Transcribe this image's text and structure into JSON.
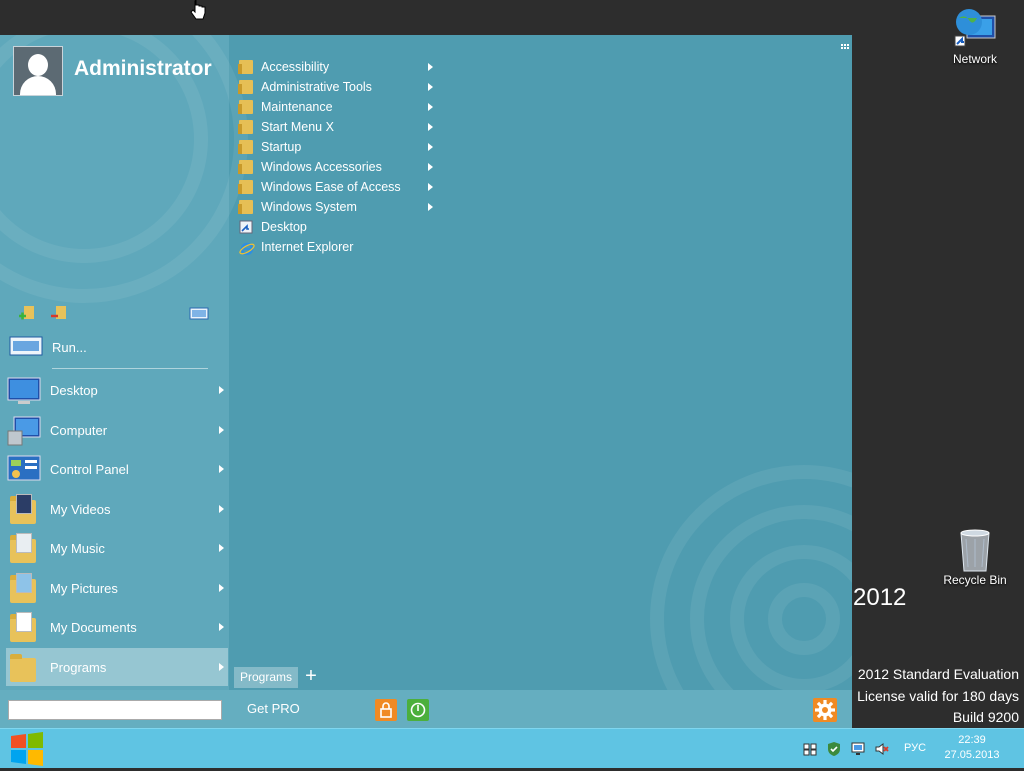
{
  "desktop": {
    "network_label": "Network",
    "recycle_label": "Recycle Bin",
    "watermark": {
      "year": "2012",
      "line1": "2012 Standard Evaluation",
      "line2": "License valid for 180 days",
      "line3": "Build 9200"
    }
  },
  "startmenu": {
    "username": "Administrator",
    "run_label": "Run...",
    "left_items": [
      {
        "label": "Desktop",
        "icon": "desktop-icon"
      },
      {
        "label": "Computer",
        "icon": "computer-icon"
      },
      {
        "label": "Control Panel",
        "icon": "control-panel-icon"
      },
      {
        "label": "My Videos",
        "icon": "videos-folder-icon"
      },
      {
        "label": "My Music",
        "icon": "music-folder-icon"
      },
      {
        "label": "My Pictures",
        "icon": "pictures-folder-icon"
      },
      {
        "label": "My Documents",
        "icon": "documents-folder-icon"
      },
      {
        "label": "Programs",
        "icon": "programs-folder-icon"
      }
    ],
    "programs": [
      {
        "label": "Accessibility",
        "type": "folder"
      },
      {
        "label": "Administrative Tools",
        "type": "folder"
      },
      {
        "label": "Maintenance",
        "type": "folder"
      },
      {
        "label": "Start Menu X",
        "type": "folder"
      },
      {
        "label": "Startup",
        "type": "folder"
      },
      {
        "label": "Windows Accessories",
        "type": "folder"
      },
      {
        "label": "Windows Ease of Access",
        "type": "folder"
      },
      {
        "label": "Windows System",
        "type": "folder"
      },
      {
        "label": "Desktop",
        "type": "shortcut"
      },
      {
        "label": "Internet Explorer",
        "type": "ie"
      }
    ],
    "tab_label": "Programs",
    "tab_add": "+",
    "search": {
      "value": "",
      "placeholder": ""
    },
    "get_pro": "Get PRO"
  },
  "taskbar": {
    "language": "РУС",
    "time": "22:39",
    "date": "27.05.2013"
  },
  "colors": {
    "menu_bg": "#4f9cb0",
    "left_bg": "#5fa8bb",
    "taskbar": "#5fc4e3",
    "accent_orange": "#f08a24",
    "power_green": "#4caf3c"
  }
}
